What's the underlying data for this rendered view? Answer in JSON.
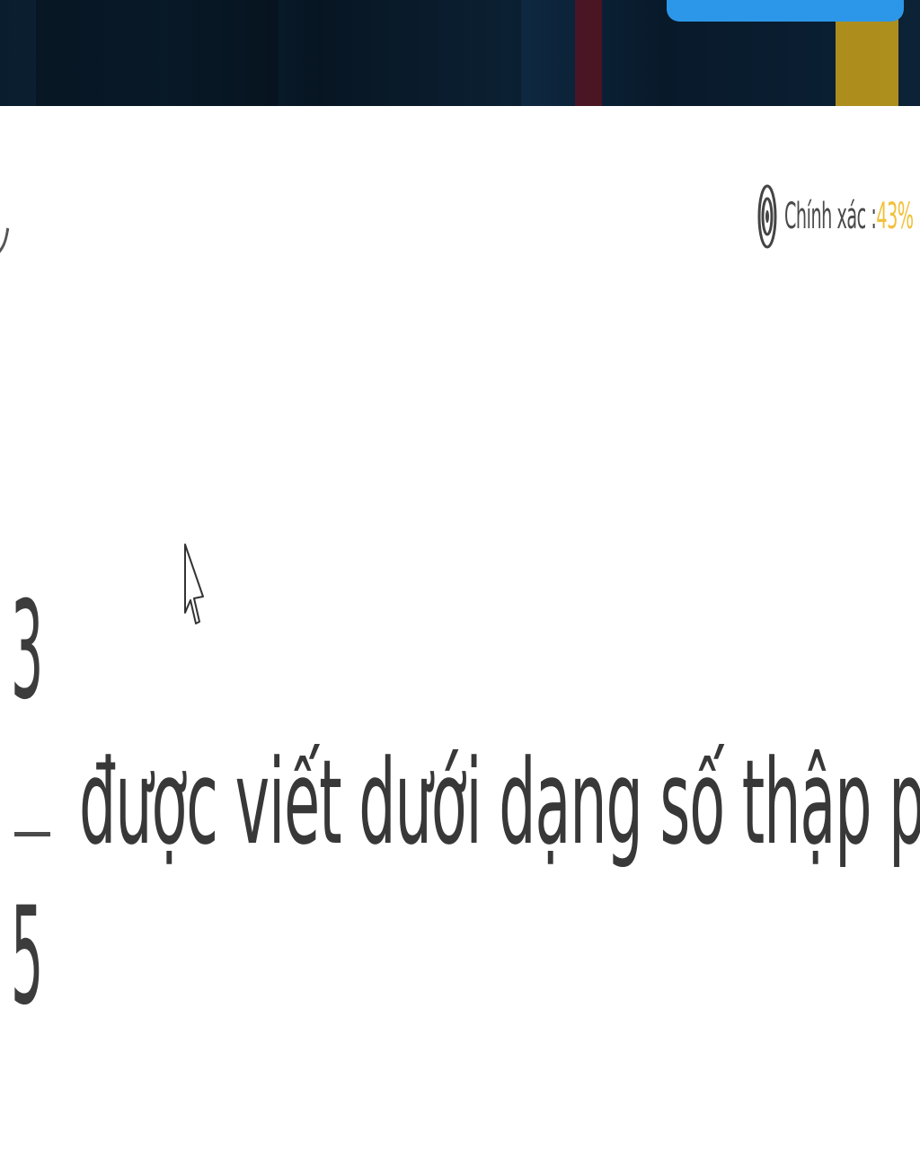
{
  "accuracy": {
    "label": "Chính xác :",
    "value": "43%",
    "icon": "target-icon",
    "value_color": "#f1c13a"
  },
  "question": {
    "fraction": {
      "numerator": "3",
      "denominator": "5"
    },
    "text": "được viết dưới dạng số thập phân là:"
  },
  "colors": {
    "banner_button": "#2c97e8",
    "banner_background": "#0a1d2e"
  }
}
